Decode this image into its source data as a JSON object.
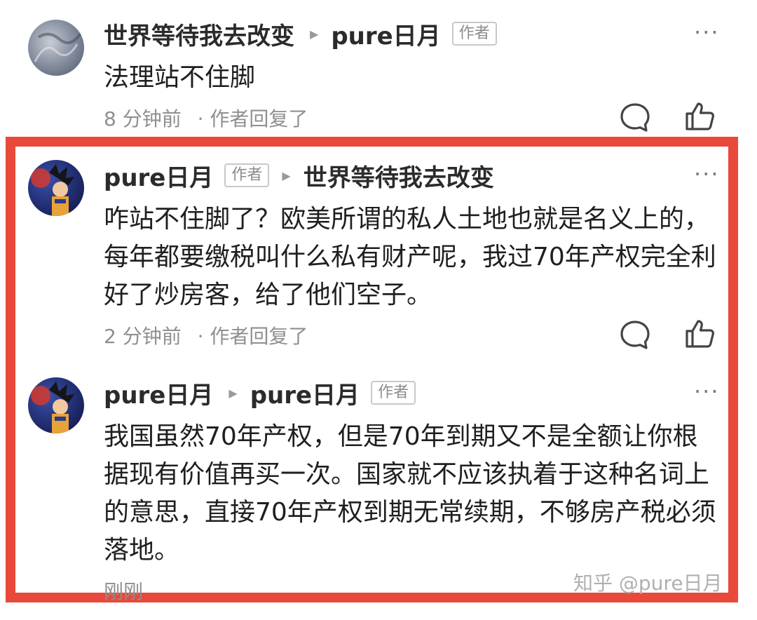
{
  "comments": [
    {
      "author": "世界等待我去改变",
      "reply_to": "pure日月",
      "author_tag": "",
      "reply_tag": "作者",
      "text": "法理站不住脚",
      "time": "8 分钟前",
      "meta_suffix": "· 作者回复了"
    },
    {
      "author": "pure日月",
      "author_tag": "作者",
      "reply_to": "世界等待我去改变",
      "reply_tag": "",
      "text": "咋站不住脚了？欧美所谓的私人土地也就是名义上的，每年都要缴税叫什么私有财产呢，我过70年产权完全利好了炒房客，给了他们空子。",
      "time": "2 分钟前",
      "meta_suffix": "· 作者回复了"
    },
    {
      "author": "pure日月",
      "author_tag": "",
      "reply_to": "pure日月",
      "reply_tag": "作者",
      "text": "我国虽然70年产权，但是70年到期又不是全额让你根据现有价值再买一次。国家就不应该执着于这种名词上的意思，直接70年产权到期无常续期，不够房产税必须落地。",
      "time": "刚刚",
      "meta_suffix": ""
    }
  ],
  "ui": {
    "more": "···",
    "reply_arrow": "▶",
    "watermark": "知乎 @pure日月"
  },
  "icons": [
    "comment-bubble-icon",
    "thumbs-up-icon"
  ],
  "colors": {
    "highlight_border": "#e8493a"
  }
}
